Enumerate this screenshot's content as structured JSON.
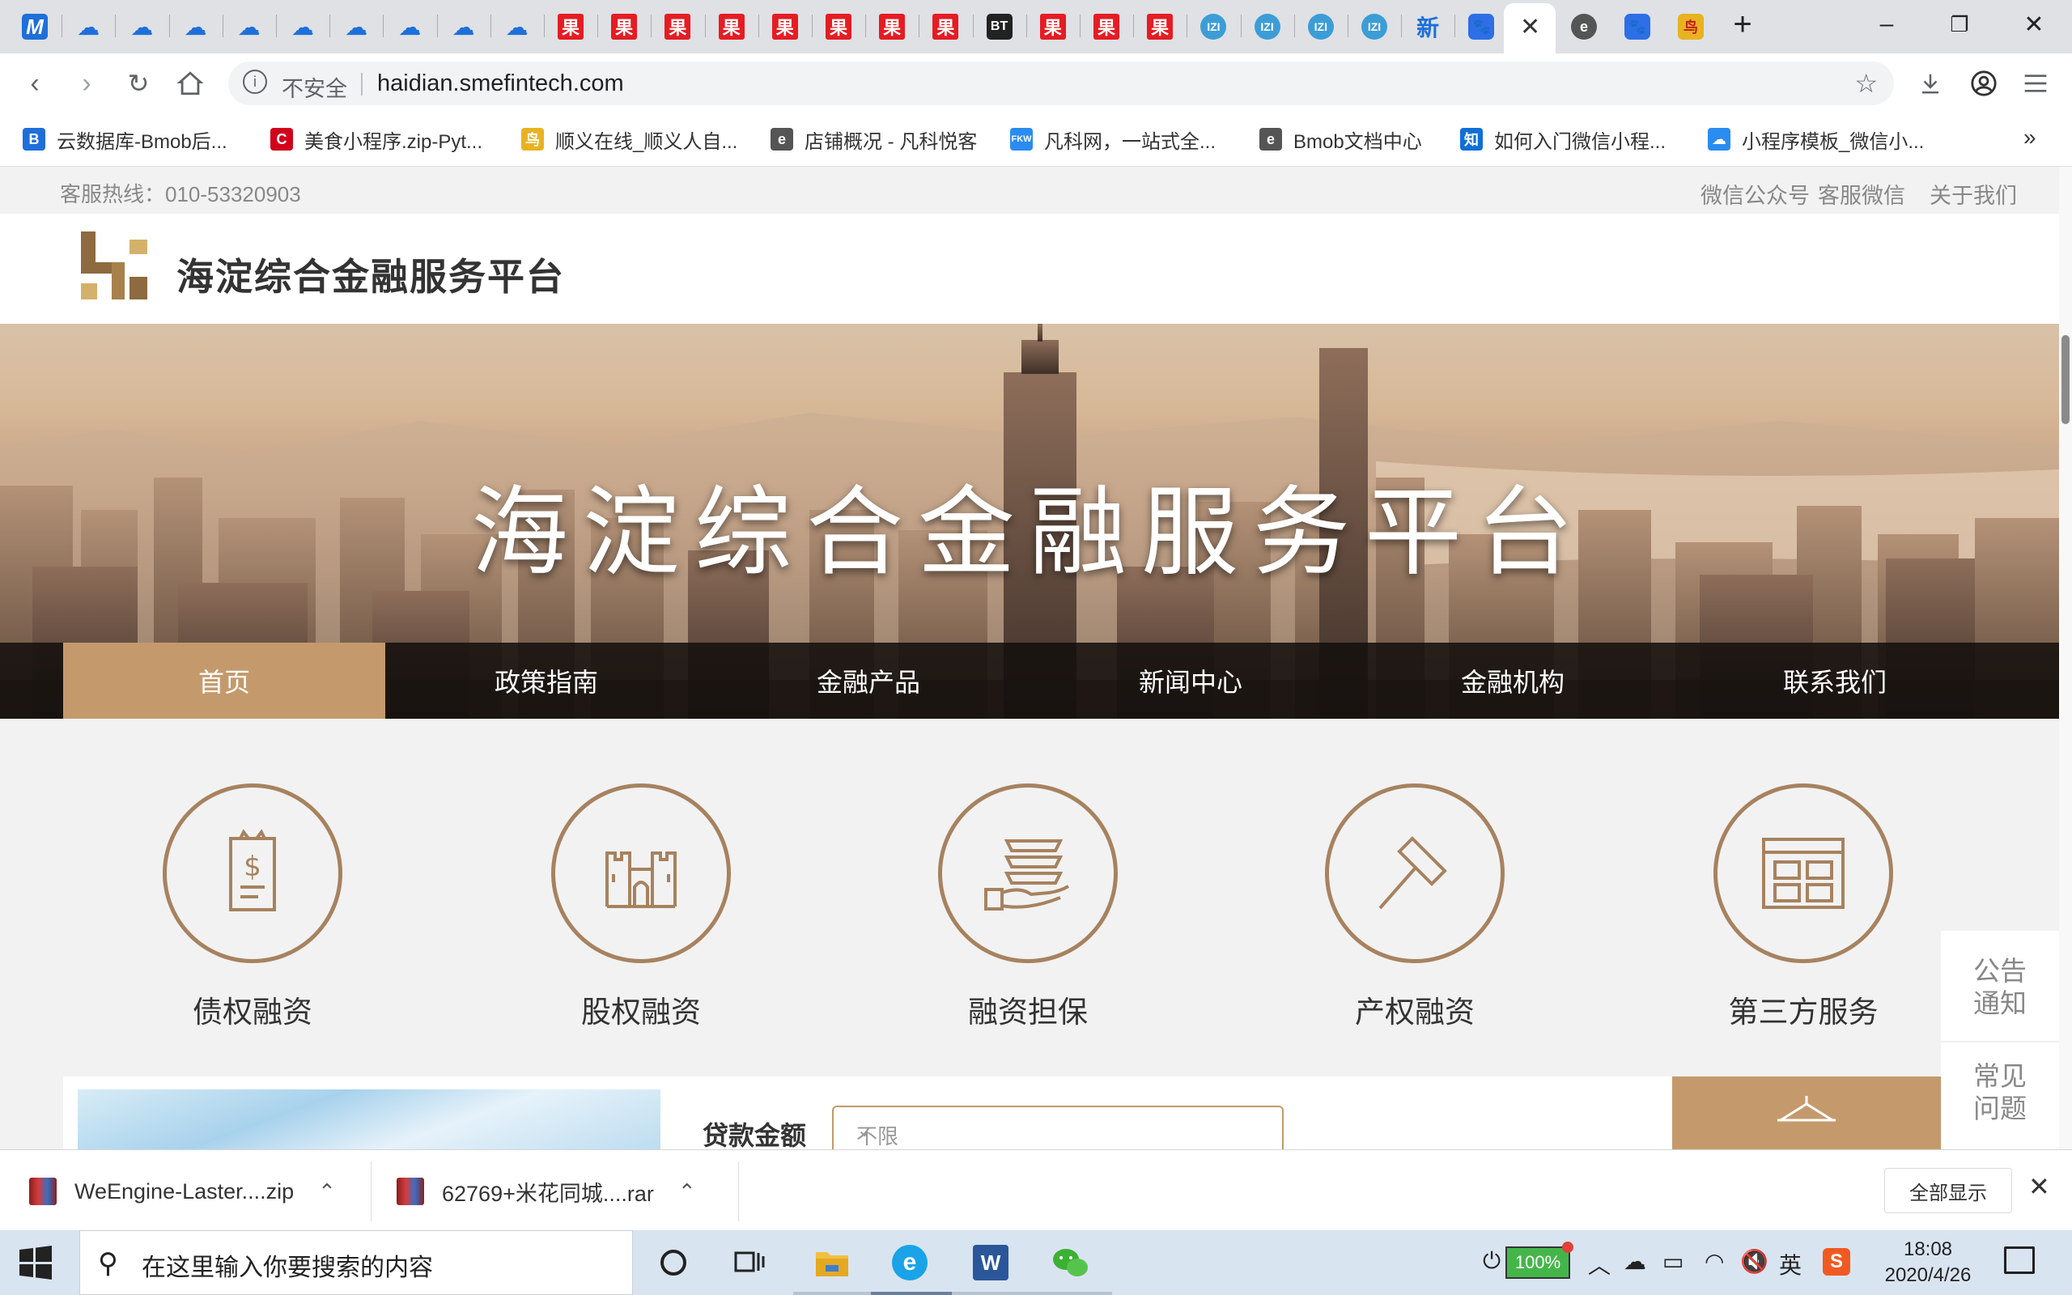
{
  "browser": {
    "tabs": [
      {
        "icon": "m-icon",
        "glyph": "M",
        "style": "m"
      },
      {
        "icon": "cloud-icon",
        "glyph": "☁",
        "style": "cloud"
      },
      {
        "icon": "cloud-icon",
        "glyph": "☁",
        "style": "cloud"
      },
      {
        "icon": "cloud-icon",
        "glyph": "☁",
        "style": "cloud"
      },
      {
        "icon": "cloud-icon",
        "glyph": "☁",
        "style": "cloud"
      },
      {
        "icon": "cloud-icon",
        "glyph": "☁",
        "style": "cloud"
      },
      {
        "icon": "cloud-icon",
        "glyph": "☁",
        "style": "cloud"
      },
      {
        "icon": "cloud-icon",
        "glyph": "☁",
        "style": "cloud"
      },
      {
        "icon": "cloud-icon",
        "glyph": "☁",
        "style": "cloud"
      },
      {
        "icon": "cloud-icon",
        "glyph": "☁",
        "style": "cloud"
      },
      {
        "icon": "guo-icon",
        "glyph": "果",
        "style": "guo"
      },
      {
        "icon": "guo-icon",
        "glyph": "果",
        "style": "guo"
      },
      {
        "icon": "guo-icon",
        "glyph": "果",
        "style": "guo"
      },
      {
        "icon": "guo-icon",
        "glyph": "果",
        "style": "guo"
      },
      {
        "icon": "guo-icon",
        "glyph": "果",
        "style": "guo"
      },
      {
        "icon": "guo-icon",
        "glyph": "果",
        "style": "guo"
      },
      {
        "icon": "guo-icon",
        "glyph": "果",
        "style": "guo"
      },
      {
        "icon": "guo-icon",
        "glyph": "果",
        "style": "guo"
      },
      {
        "icon": "bt-icon",
        "glyph": "BT",
        "style": "bt"
      },
      {
        "icon": "guo-icon",
        "glyph": "果",
        "style": "guo"
      },
      {
        "icon": "guo-icon",
        "glyph": "果",
        "style": "guo"
      },
      {
        "icon": "guo-icon",
        "glyph": "果",
        "style": "guo"
      },
      {
        "icon": "globe-icon",
        "glyph": "IZI",
        "style": "globe"
      },
      {
        "icon": "globe-icon",
        "glyph": "IZI",
        "style": "globe"
      },
      {
        "icon": "globe-icon",
        "glyph": "IZI",
        "style": "globe"
      },
      {
        "icon": "globe-icon",
        "glyph": "IZI",
        "style": "globe"
      },
      {
        "icon": "text-tab-icon",
        "glyph": "新",
        "style": "cloud"
      },
      {
        "icon": "baidu-paw-icon",
        "glyph": "🐾",
        "style": "paw"
      }
    ],
    "tabs_after": [
      {
        "icon": "circle-e-icon",
        "glyph": "e",
        "style": "circle"
      },
      {
        "icon": "baidu-paw-icon",
        "glyph": "🐾",
        "style": "paw"
      },
      {
        "icon": "gold-bird-icon",
        "glyph": "鸟",
        "style": "gold"
      }
    ],
    "security_label": "不安全",
    "url": "haidian.smefintech.com",
    "bookmarks": [
      {
        "label": "云数据库-Bmob后...",
        "icon": "bmob-icon",
        "glyph": "B",
        "color": "#1e6fd9"
      },
      {
        "label": "美食小程序.zip-Pyt...",
        "icon": "c-icon",
        "glyph": "C",
        "color": "#d0021b"
      },
      {
        "label": "顺义在线_顺义人自...",
        "icon": "bird-icon",
        "glyph": "鸟",
        "color": "#e8b321"
      },
      {
        "label": "店铺概况 - 凡科悦客",
        "icon": "circle-e-icon",
        "glyph": "e",
        "color": "#555555"
      },
      {
        "label": "凡科网，一站式全...",
        "icon": "fkw-icon",
        "glyph": "FKW",
        "color": "#2a8cf0"
      },
      {
        "label": "Bmob文档中心",
        "icon": "circle-e-icon",
        "glyph": "e",
        "color": "#555555"
      },
      {
        "label": "如何入门微信小程...",
        "icon": "zhihu-icon",
        "glyph": "知",
        "color": "#0f6fd6"
      },
      {
        "label": "小程序模板_微信小...",
        "icon": "cloud-icon",
        "glyph": "☁",
        "color": "#2a8cf0"
      }
    ],
    "bookmarks_more": "»"
  },
  "site": {
    "hotline": "客服热线：010-53320903",
    "toplinks": [
      "微信公众号",
      "客服微信",
      "关于我们"
    ],
    "logo_text": "海淀综合金融服务平台",
    "hero_title": "海淀综合金融服务平台",
    "nav": [
      "首页",
      "政策指南",
      "金融产品",
      "新闻中心",
      "金融机构",
      "联系我们"
    ],
    "nav_active_index": 0,
    "services": [
      {
        "label": "债权融资",
        "icon": "receipt-dollar-icon"
      },
      {
        "label": "股权融资",
        "icon": "castle-icon"
      },
      {
        "label": "融资担保",
        "icon": "hand-coins-icon"
      },
      {
        "label": "产权融资",
        "icon": "gavel-icon"
      },
      {
        "label": "第三方服务",
        "icon": "grid-panel-icon"
      }
    ],
    "side": [
      "公告\n通知",
      "常见\n问题"
    ],
    "loan_label": "贷款金额",
    "loan_select_value": "不限",
    "accent_color": "#c49a6c"
  },
  "downloads": [
    {
      "name": "WeEngine-Laster....zip"
    },
    {
      "name": "62769+米花同城....rar"
    }
  ],
  "downloads_show_all": "全部显示",
  "taskbar": {
    "search_placeholder": "在这里输入你要搜索的内容",
    "battery": "100%",
    "ime": "英",
    "time": "18:08",
    "date": "2020/4/26"
  }
}
